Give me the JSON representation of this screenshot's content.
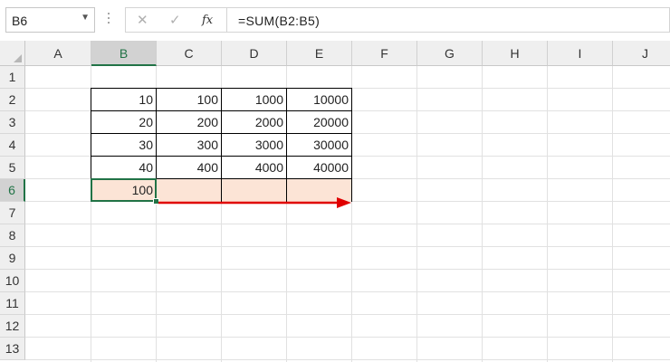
{
  "name_box": {
    "value": "B6",
    "dropdown_icon": "chevron-down-icon"
  },
  "formula_bar": {
    "cancel_icon": "close-icon",
    "enter_icon": "check-icon",
    "fx_label": "fx",
    "formula": "=SUM(B2:B5)"
  },
  "columns": [
    "A",
    "B",
    "C",
    "D",
    "E",
    "F",
    "G",
    "H",
    "I",
    "J"
  ],
  "rows": [
    "1",
    "2",
    "3",
    "4",
    "5",
    "6",
    "7",
    "8",
    "9",
    "10",
    "11",
    "12",
    "13"
  ],
  "selected": {
    "column": "B",
    "row": "6"
  },
  "cells": {
    "B2": "10",
    "C2": "100",
    "D2": "1000",
    "E2": "10000",
    "B3": "20",
    "C3": "200",
    "D3": "2000",
    "E3": "20000",
    "B4": "30",
    "C4": "300",
    "D4": "3000",
    "E4": "30000",
    "B5": "40",
    "C5": "400",
    "D5": "4000",
    "E5": "40000",
    "B6": "100"
  },
  "colors": {
    "accent": "#217346",
    "highlight_fill": "#fce4d6",
    "arrow": "#e00000"
  },
  "annotation": {
    "type": "arrow",
    "direction": "right",
    "meaning": "fill B6 formula to E6"
  }
}
